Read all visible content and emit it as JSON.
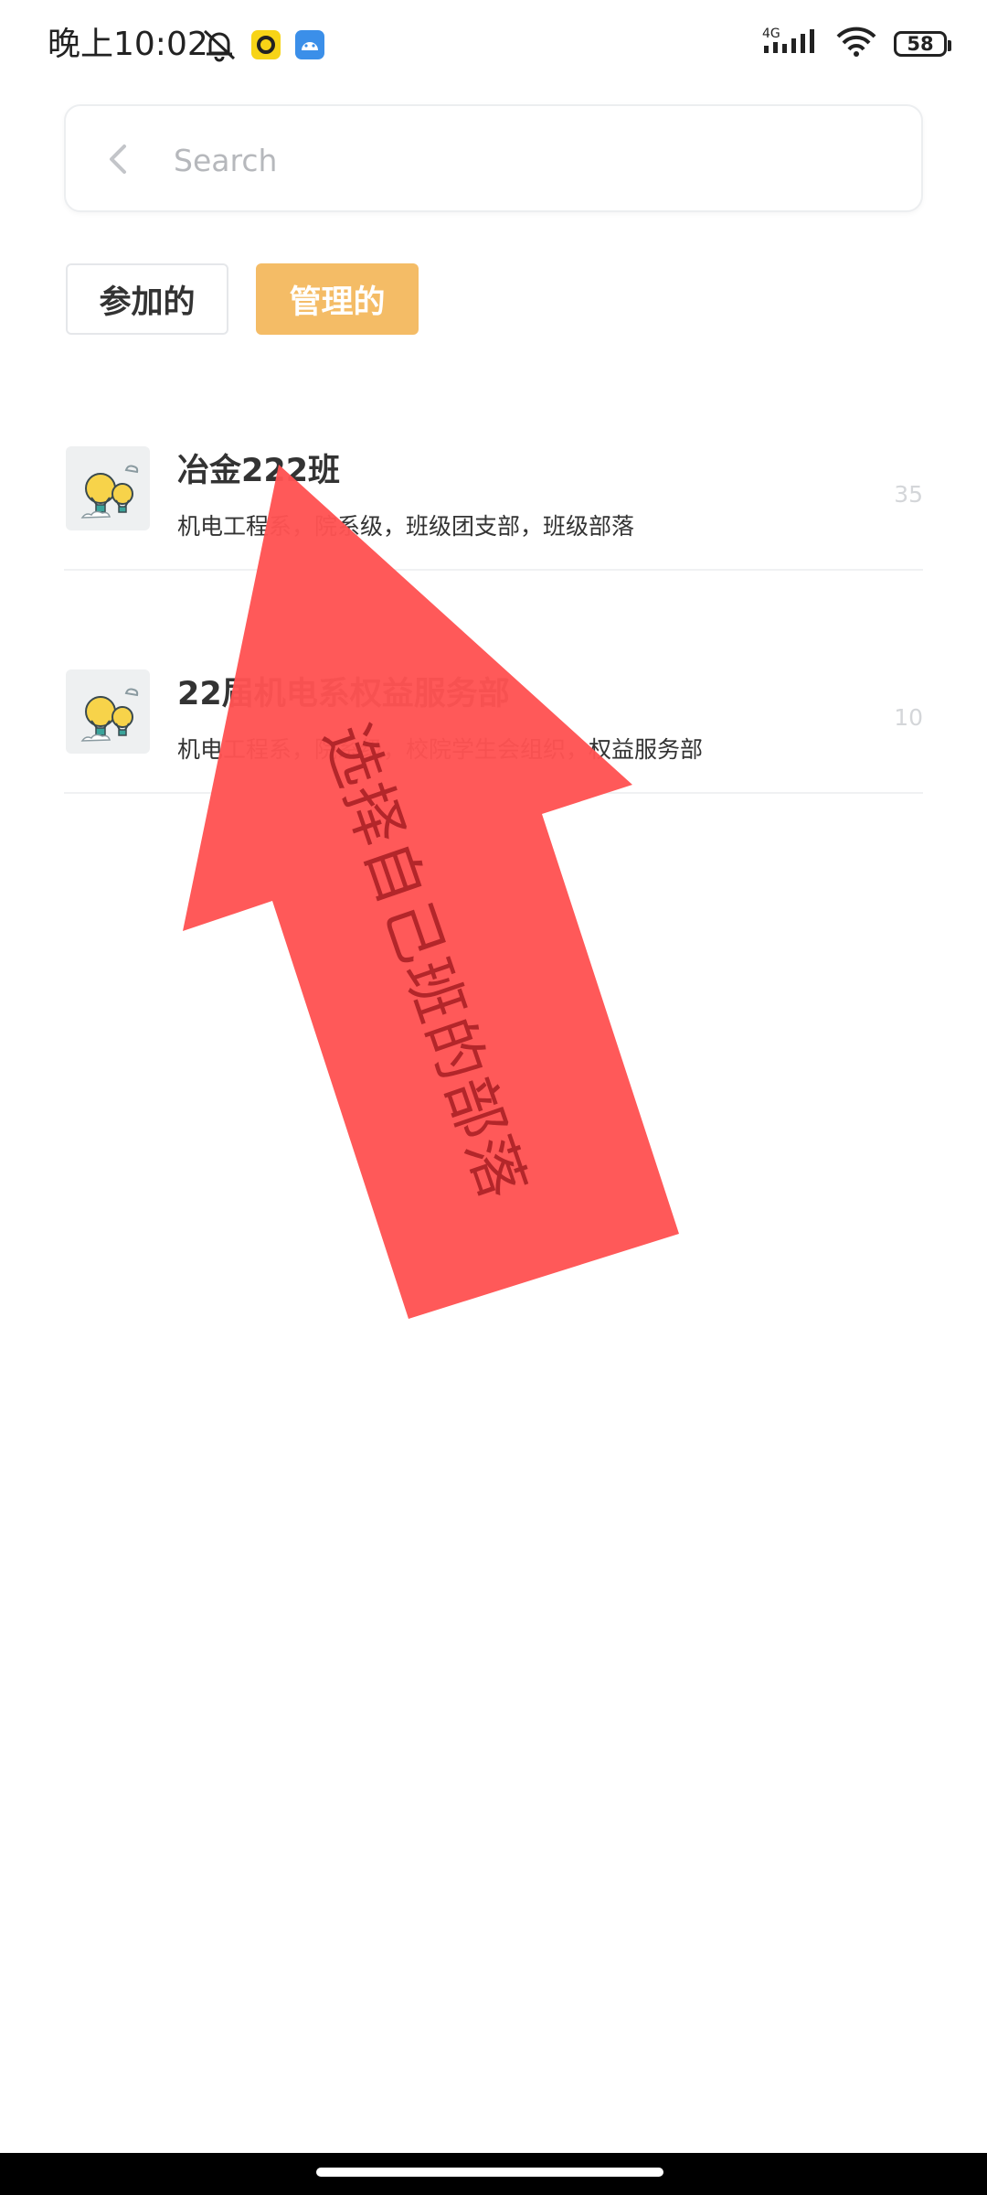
{
  "status_bar": {
    "time": "晚上10:02",
    "network": "4G",
    "battery": "58",
    "icons": [
      "mute-bell-icon",
      "app-notification-icon",
      "android-icon",
      "signal-icon",
      "wifi-icon",
      "battery-icon"
    ]
  },
  "search": {
    "placeholder": "Search",
    "value": ""
  },
  "tabs": [
    {
      "label": "参加的",
      "active": false
    },
    {
      "label": "管理的",
      "active": true
    }
  ],
  "tribes": [
    {
      "name": "冶金222班",
      "tags": "机电工程系，院系级，班级团支部，班级部落",
      "count": "35"
    },
    {
      "name": "22届机电系权益服务部",
      "tags": "机电工程系，院系级，校院学生会组织，权益服务部",
      "count": "10"
    }
  ],
  "annotation": {
    "caption": "选择自己班的部落"
  },
  "colors": {
    "accent": "#f4bc66",
    "arrow_fill": "#ff5252",
    "caption": "#b3262a"
  }
}
